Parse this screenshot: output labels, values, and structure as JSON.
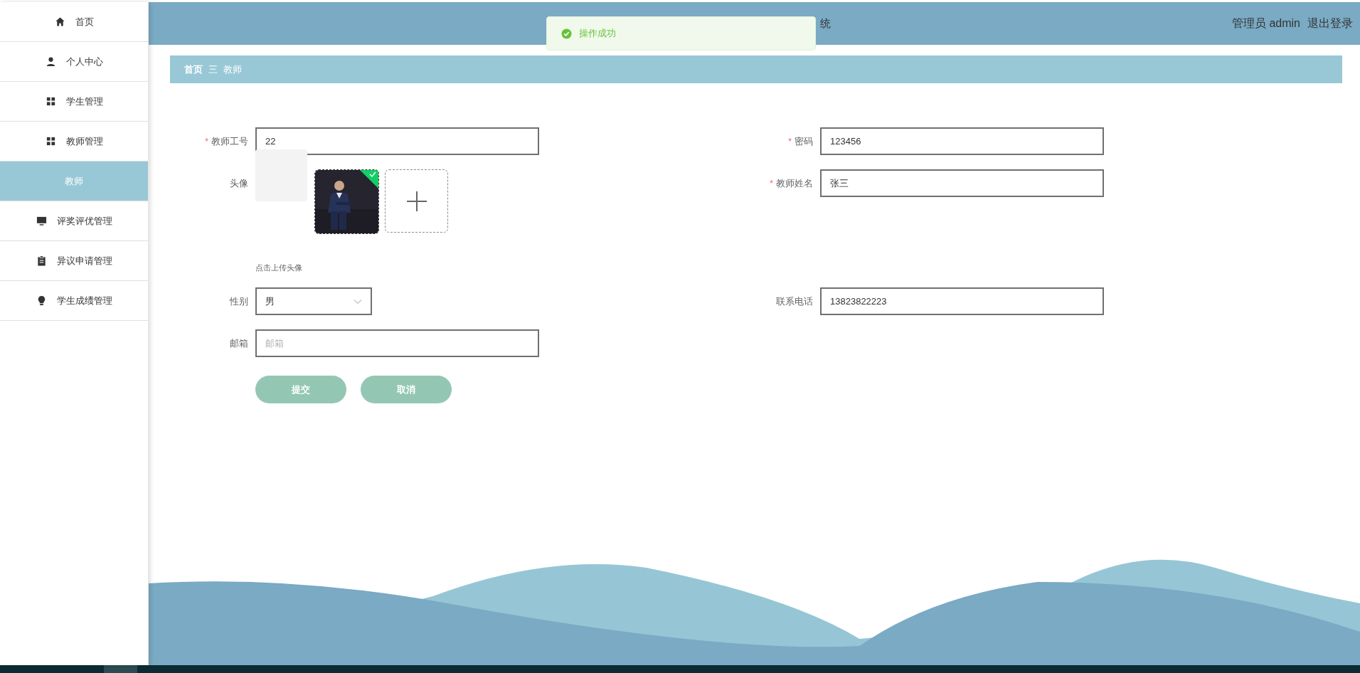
{
  "sidebar": {
    "items": [
      {
        "label": "首页",
        "kind": "home",
        "selected": false
      },
      {
        "label": "个人中心",
        "kind": "user",
        "selected": false
      },
      {
        "label": "学生管理",
        "kind": "grid",
        "selected": false
      },
      {
        "label": "教师管理",
        "kind": "grid",
        "selected": false
      },
      {
        "label": "教师",
        "kind": "submenu",
        "selected": true
      },
      {
        "label": "评奖评优管理",
        "kind": "monitor",
        "selected": false
      },
      {
        "label": "异议申请管理",
        "kind": "clipboard",
        "selected": false
      },
      {
        "label": "学生成绩管理",
        "kind": "bulb",
        "selected": false
      }
    ]
  },
  "header": {
    "title": "统",
    "user": "管理员 admin",
    "logout": "退出登录"
  },
  "toast": {
    "success": true,
    "message": "操作成功"
  },
  "breadcrumb": {
    "items": [
      "首页",
      "教师"
    ],
    "separator": "三"
  },
  "form": {
    "rows": [
      [
        {
          "kind": "input",
          "required_mark": "*",
          "label": "教师工号",
          "value": "22"
        },
        {
          "kind": "input",
          "required_mark": "*",
          "label": "密码",
          "value": "123456"
        }
      ],
      [
        {
          "kind": "upload",
          "label": "头像",
          "hint": "点击上传头像"
        },
        {
          "kind": "input",
          "required_mark": "*",
          "label": "教师姓名",
          "value": "张三"
        }
      ],
      [
        {
          "kind": "select",
          "label": "性别",
          "value": "男"
        },
        {
          "kind": "input",
          "label": "联系电话",
          "value": "13823822223"
        }
      ],
      [
        {
          "kind": "input",
          "label": "邮箱",
          "placeholder": "邮箱"
        }
      ]
    ],
    "buttons": [
      "提交",
      "取消"
    ]
  }
}
